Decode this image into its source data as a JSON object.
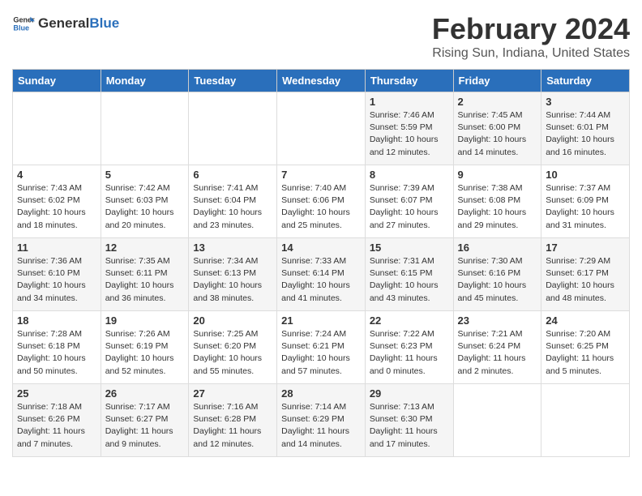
{
  "header": {
    "logo_general": "General",
    "logo_blue": "Blue",
    "month_title": "February 2024",
    "location": "Rising Sun, Indiana, United States"
  },
  "weekdays": [
    "Sunday",
    "Monday",
    "Tuesday",
    "Wednesday",
    "Thursday",
    "Friday",
    "Saturday"
  ],
  "weeks": [
    [
      {
        "day": "",
        "info": ""
      },
      {
        "day": "",
        "info": ""
      },
      {
        "day": "",
        "info": ""
      },
      {
        "day": "",
        "info": ""
      },
      {
        "day": "1",
        "info": "Sunrise: 7:46 AM\nSunset: 5:59 PM\nDaylight: 10 hours\nand 12 minutes."
      },
      {
        "day": "2",
        "info": "Sunrise: 7:45 AM\nSunset: 6:00 PM\nDaylight: 10 hours\nand 14 minutes."
      },
      {
        "day": "3",
        "info": "Sunrise: 7:44 AM\nSunset: 6:01 PM\nDaylight: 10 hours\nand 16 minutes."
      }
    ],
    [
      {
        "day": "4",
        "info": "Sunrise: 7:43 AM\nSunset: 6:02 PM\nDaylight: 10 hours\nand 18 minutes."
      },
      {
        "day": "5",
        "info": "Sunrise: 7:42 AM\nSunset: 6:03 PM\nDaylight: 10 hours\nand 20 minutes."
      },
      {
        "day": "6",
        "info": "Sunrise: 7:41 AM\nSunset: 6:04 PM\nDaylight: 10 hours\nand 23 minutes."
      },
      {
        "day": "7",
        "info": "Sunrise: 7:40 AM\nSunset: 6:06 PM\nDaylight: 10 hours\nand 25 minutes."
      },
      {
        "day": "8",
        "info": "Sunrise: 7:39 AM\nSunset: 6:07 PM\nDaylight: 10 hours\nand 27 minutes."
      },
      {
        "day": "9",
        "info": "Sunrise: 7:38 AM\nSunset: 6:08 PM\nDaylight: 10 hours\nand 29 minutes."
      },
      {
        "day": "10",
        "info": "Sunrise: 7:37 AM\nSunset: 6:09 PM\nDaylight: 10 hours\nand 31 minutes."
      }
    ],
    [
      {
        "day": "11",
        "info": "Sunrise: 7:36 AM\nSunset: 6:10 PM\nDaylight: 10 hours\nand 34 minutes."
      },
      {
        "day": "12",
        "info": "Sunrise: 7:35 AM\nSunset: 6:11 PM\nDaylight: 10 hours\nand 36 minutes."
      },
      {
        "day": "13",
        "info": "Sunrise: 7:34 AM\nSunset: 6:13 PM\nDaylight: 10 hours\nand 38 minutes."
      },
      {
        "day": "14",
        "info": "Sunrise: 7:33 AM\nSunset: 6:14 PM\nDaylight: 10 hours\nand 41 minutes."
      },
      {
        "day": "15",
        "info": "Sunrise: 7:31 AM\nSunset: 6:15 PM\nDaylight: 10 hours\nand 43 minutes."
      },
      {
        "day": "16",
        "info": "Sunrise: 7:30 AM\nSunset: 6:16 PM\nDaylight: 10 hours\nand 45 minutes."
      },
      {
        "day": "17",
        "info": "Sunrise: 7:29 AM\nSunset: 6:17 PM\nDaylight: 10 hours\nand 48 minutes."
      }
    ],
    [
      {
        "day": "18",
        "info": "Sunrise: 7:28 AM\nSunset: 6:18 PM\nDaylight: 10 hours\nand 50 minutes."
      },
      {
        "day": "19",
        "info": "Sunrise: 7:26 AM\nSunset: 6:19 PM\nDaylight: 10 hours\nand 52 minutes."
      },
      {
        "day": "20",
        "info": "Sunrise: 7:25 AM\nSunset: 6:20 PM\nDaylight: 10 hours\nand 55 minutes."
      },
      {
        "day": "21",
        "info": "Sunrise: 7:24 AM\nSunset: 6:21 PM\nDaylight: 10 hours\nand 57 minutes."
      },
      {
        "day": "22",
        "info": "Sunrise: 7:22 AM\nSunset: 6:23 PM\nDaylight: 11 hours\nand 0 minutes."
      },
      {
        "day": "23",
        "info": "Sunrise: 7:21 AM\nSunset: 6:24 PM\nDaylight: 11 hours\nand 2 minutes."
      },
      {
        "day": "24",
        "info": "Sunrise: 7:20 AM\nSunset: 6:25 PM\nDaylight: 11 hours\nand 5 minutes."
      }
    ],
    [
      {
        "day": "25",
        "info": "Sunrise: 7:18 AM\nSunset: 6:26 PM\nDaylight: 11 hours\nand 7 minutes."
      },
      {
        "day": "26",
        "info": "Sunrise: 7:17 AM\nSunset: 6:27 PM\nDaylight: 11 hours\nand 9 minutes."
      },
      {
        "day": "27",
        "info": "Sunrise: 7:16 AM\nSunset: 6:28 PM\nDaylight: 11 hours\nand 12 minutes."
      },
      {
        "day": "28",
        "info": "Sunrise: 7:14 AM\nSunset: 6:29 PM\nDaylight: 11 hours\nand 14 minutes."
      },
      {
        "day": "29",
        "info": "Sunrise: 7:13 AM\nSunset: 6:30 PM\nDaylight: 11 hours\nand 17 minutes."
      },
      {
        "day": "",
        "info": ""
      },
      {
        "day": "",
        "info": ""
      }
    ]
  ]
}
